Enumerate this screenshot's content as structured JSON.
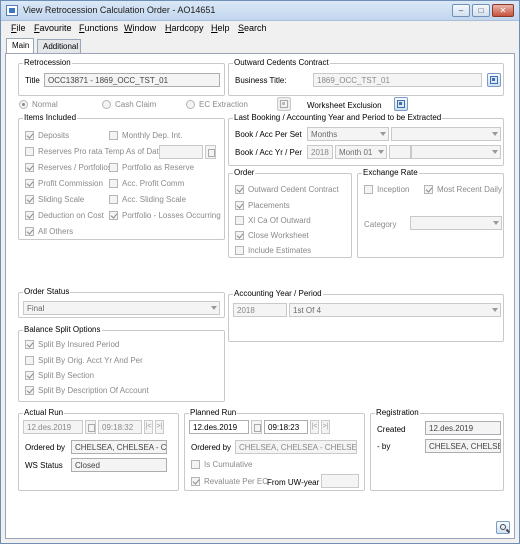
{
  "window": {
    "title": "View Retrocession Calculation Order - AO14651"
  },
  "menu": [
    "File",
    "Favourite",
    "Functions",
    "Window",
    "Hardcopy",
    "Help",
    "Search"
  ],
  "tabs": [
    "Main",
    "Additional"
  ],
  "retrocession": {
    "group": "Retrocession",
    "title_label": "Title",
    "title_value": "OCC13871 - 1869_OCC_TST_01"
  },
  "outward": {
    "group": "Outward Cedents Contract",
    "business_label": "Business Title:",
    "business_value": "1869_OCC_TST_01"
  },
  "radios": {
    "normal": "Normal",
    "cash_claim": "Cash Claim",
    "ec_extraction": "EC Extraction",
    "worksheet_exclusion": "Worksheet Exclusion"
  },
  "items_included": {
    "group": "Items Included",
    "deposits": "Deposits",
    "monthly_dep_int": "Monthly Dep. Int.",
    "reserves_pro_rata": "Reserves Pro rata Temp As of Date",
    "reserves_portfolios": "Reserves / Portfolios",
    "portfolio_as_reserve": "Portfolio as Reserve",
    "profit_commission": "Profit Commission",
    "acc_profit_comm": "Acc. Profit Comm",
    "sliding_scale": "Sliding Scale",
    "acc_sliding_scale": "Acc. Sliding Scale",
    "deduction_on_cost": "Deduction on Cost",
    "portfolio_losses": "Portfolio - Losses Occurring",
    "all_others": "All Others"
  },
  "last_booking": {
    "group": "Last Booking / Accounting Year and Period to be Extracted",
    "per_set_label": "Book / Acc Per Set",
    "per_set_value": "Months",
    "yr_per_label": "Book / Acc Yr / Per",
    "year_value": "2018",
    "month_value": "Month 01"
  },
  "order": {
    "group": "Order",
    "outward_cedent_contract": "Outward Cedent Contract",
    "placements": "Placements",
    "xl_ca": "Xl Ca Of Outward",
    "close_worksheet": "Close Worksheet",
    "include_estimates": "Include Estimates"
  },
  "exchange_rate": {
    "group": "Exchange Rate",
    "inception": "Inception",
    "most_recent_daily": "Most Recent Daily",
    "category_label": "Category"
  },
  "order_status": {
    "group": "Order Status",
    "value": "Final"
  },
  "accounting_year": {
    "group": "Accounting Year / Period",
    "year": "2018",
    "period": "1st Of 4"
  },
  "balance_split": {
    "group": "Balance Split Options",
    "insured_period": "Split By Insured Period",
    "orig_acct_yr": "Split By Orig. Acct Yr And Per",
    "section": "Split By Section",
    "description": "Split By Description Of Account"
  },
  "actual_run": {
    "group": "Actual Run",
    "date": "12.des.2019",
    "time": "09:18:32",
    "ordered_by_label": "Ordered by",
    "ordered_by": "CHELSEA, CHELSEA - CH",
    "ws_status_label": "WS Status",
    "ws_status": "Closed"
  },
  "planned_run": {
    "group": "Planned Run",
    "date": "12.des.2019",
    "time": "09:18:23",
    "ordered_by_label": "Ordered by",
    "ordered_by": "CHELSEA, CHELSEA - CHELSEA",
    "is_cumulative": "Is Cumulative",
    "revaluate": "Revaluate Per EC",
    "from_uw_year": "From UW-year"
  },
  "registration": {
    "group": "Registration",
    "created_label": "Created",
    "created": "12.des.2019",
    "by_label": "- by",
    "by": "CHELSEA, CHELSEA"
  }
}
